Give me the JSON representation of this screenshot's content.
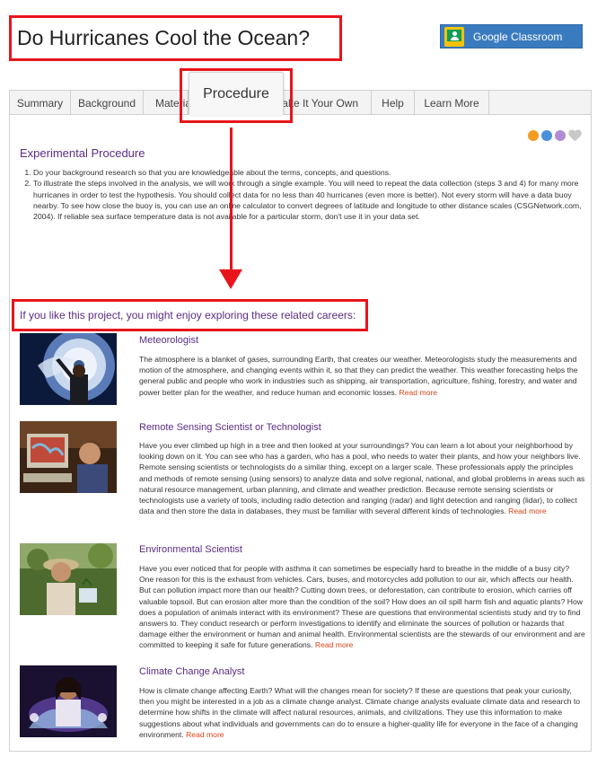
{
  "page_title": "Do Hurricanes Cool the Ocean?",
  "google_classroom_label": "Google Classroom",
  "tabs": [
    {
      "label": "Summary"
    },
    {
      "label": "Background"
    },
    {
      "label": "Material"
    },
    {
      "label": "Procedure"
    },
    {
      "label": "Make It Your Own"
    },
    {
      "label": "Help"
    },
    {
      "label": "Learn More"
    }
  ],
  "procedure": {
    "heading": "Experimental Procedure",
    "steps": [
      "Do your background research so that you are knowledgeable about the terms, concepts, and questions.",
      "To illustrate the steps involved in the analysis, we will work through a single example. You will need to repeat the data collection (steps 3 and 4) for many more hurricanes in order to test the hypothesis. You should collect data for no less than 40 hurricanes (even more is better). Not every storm will have a data buoy nearby. To see how close the buoy is, you can use an online calculator to convert degrees of latitude and longitude to other distance scales (CSGNetwork.com, 2004). If reliable sea surface temperature data is not available for a particular storm, don't use it in your data set."
    ]
  },
  "careers_heading": "If you like this project, you might enjoy exploring these related careers:",
  "read_more_label": "Read more",
  "careers": [
    {
      "title": "Meteorologist",
      "description": "The atmosphere is a blanket of gases, surrounding Earth, that creates our weather. Meteorologists study the measurements and motion of the atmosphere, and changing events within it, so that they can predict the weather. This weather forecasting helps the general public and people who work in industries such as shipping, air transportation, agriculture, fishing, forestry, and water and power better plan for the weather, and reduce human and economic losses."
    },
    {
      "title": "Remote Sensing Scientist or Technologist",
      "description": "Have you ever climbed up high in a tree and then looked at your surroundings? You can learn a lot about your neighborhood by looking down on it. You can see who has a garden, who has a pool, who needs to water their plants, and how your neighbors live. Remote sensing scientists or technologists do a similar thing, except on a larger scale. These professionals apply the principles and methods of remote sensing (using sensors) to analyze data and solve regional, national, and global problems in areas such as natural resource management, urban planning, and climate and weather prediction. Because remote sensing scientists or technologists use a variety of tools, including radio detection and ranging (radar) and light detection and ranging (lidar), to collect data and then store the data in databases, they must be familiar with several different kinds of technologies."
    },
    {
      "title": "Environmental Scientist",
      "description": "Have you ever noticed that for people with asthma it can sometimes be especially hard to breathe in the middle of a busy city? One reason for this is the exhaust from vehicles. Cars, buses, and motorcycles add pollution to our air, which affects our health. But can pollution impact more than our health? Cutting down trees, or deforestation, can contribute to erosion, which carries off valuable topsoil. But can erosion alter more than the condition of the soil? How does an oil spill harm fish and aquatic plants? How does a population of animals interact with its environment? These are questions that environmental scientists study and try to find answers to. They conduct research or perform investigations to identify and eliminate the sources of pollution or hazards that damage either the environment or human and animal health. Environmental scientists are the stewards of our environment and are committed to keeping it safe for future generations."
    },
    {
      "title": "Climate Change Analyst",
      "description": "How is climate change affecting Earth? What will the changes mean for society? If these are questions that peak your curiosity, then you might be interested in a job as a climate change analyst. Climate change analysts evaluate climate data and research to determine how shifts in the climate will affect natural resources, animals, and civilizations. They use this information to make suggestions about what individuals and governments can do to ensure a higher-quality life for everyone in the face of a changing environment."
    }
  ],
  "colors": {
    "annotation_red": "#e8141b",
    "heading_purple": "#5b2c83",
    "read_more_orange": "#d9441a",
    "classroom_blue": "#3a7bbf"
  }
}
